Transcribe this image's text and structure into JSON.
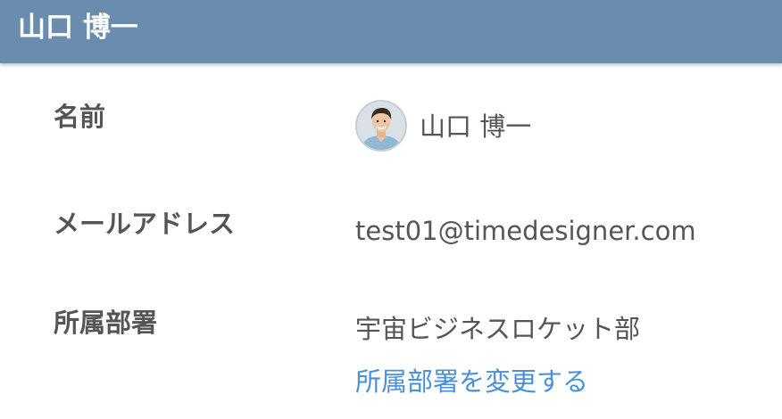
{
  "header": {
    "title": "山口 博一"
  },
  "profile": {
    "name_label": "名前",
    "name_value": "山口 博一",
    "email_label": "メールアドレス",
    "email_value": "test01@timedesigner.com",
    "department_label": "所属部署",
    "department_value": "宇宙ビジネスロケット部",
    "change_department_link": "所属部署を変更する"
  },
  "colors": {
    "header_bg": "#6a8caf",
    "link": "#4a90d9",
    "text": "#555555"
  }
}
